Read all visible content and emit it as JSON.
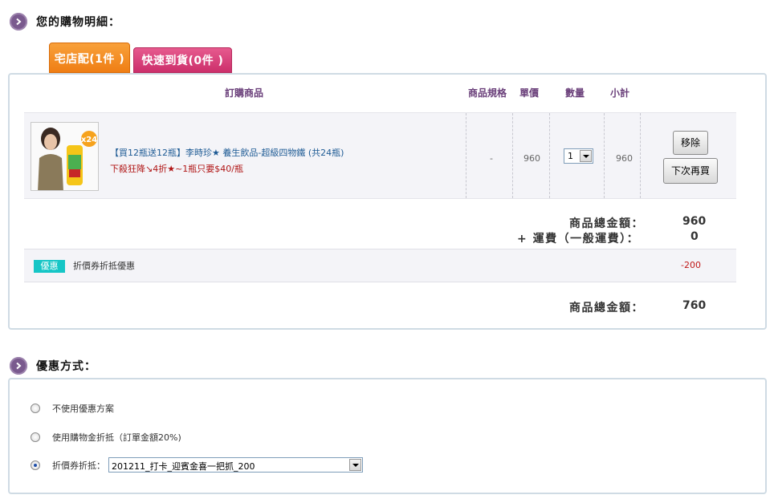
{
  "cart_section": {
    "title": "您的購物明細：",
    "icon": "chevron-right-icon"
  },
  "tabs": [
    {
      "label": "宅店配(1件 )",
      "color": "#f08a20",
      "active": true
    },
    {
      "label": "快速到貨(0件 )",
      "color": "#d63a75",
      "active": false
    }
  ],
  "table": {
    "headers": {
      "product": "訂購商品",
      "spec": "商品規格",
      "price": "單價",
      "qty": "數量",
      "subtotal": "小計"
    },
    "rows": [
      {
        "name": "【買12瓶送12瓶】李時珍★ 養生飲品-超級四物鐵 (共24瓶)",
        "promo": "下殺狂降↘4折★~1瓶只要$40/瓶",
        "badge_text": "x24",
        "spec": "-",
        "price": "960",
        "qty": "1",
        "subtotal": "960",
        "remove_label": "移除",
        "later_label": "下次再買"
      }
    ]
  },
  "summary": {
    "goods_total_label": "商品總金額：",
    "goods_total_value": "960",
    "shipping_label": "+ 運費（一般運費）：",
    "shipping_value": "0",
    "coupon_badge": "優惠",
    "coupon_label": "折價券折抵優惠",
    "coupon_amount": "-200",
    "final_label": "商品總金額：",
    "final_value": "760"
  },
  "discount_section": {
    "title": "優惠方式：",
    "icon": "chevron-right-icon",
    "options": [
      {
        "label": "不使用優惠方案",
        "selected": false
      },
      {
        "label": "使用購物金折抵（訂單金額20%)",
        "selected": false
      },
      {
        "label": "折價券折抵：",
        "selected": true
      }
    ],
    "coupon_select_value": "201211_打卡_迎賓金喜一把抓_200"
  }
}
